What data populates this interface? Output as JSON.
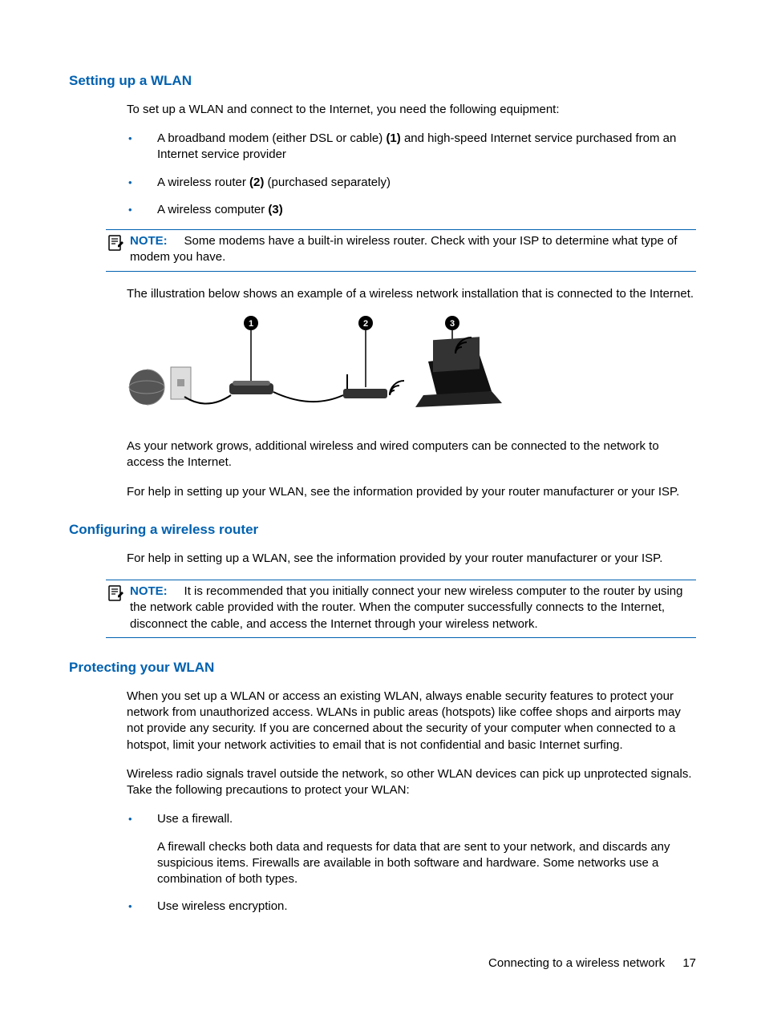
{
  "sec1": {
    "heading": "Setting up a WLAN",
    "intro": "To set up a WLAN and connect to the Internet, you need the following equipment:",
    "bullets": [
      {
        "pre": "A broadband modem (either DSL or cable) ",
        "bold": "(1)",
        "post": " and high-speed Internet service purchased from an Internet service provider"
      },
      {
        "pre": "A wireless router ",
        "bold": "(2)",
        "post": " (purchased separately)"
      },
      {
        "pre": "A wireless computer ",
        "bold": "(3)",
        "post": ""
      }
    ],
    "note_label": "NOTE:",
    "note_text": "Some modems have a built-in wireless router. Check with your ISP to determine what type of modem you have.",
    "illus_caption": "The illustration below shows an example of a wireless network installation that is connected to the Internet.",
    "after1": "As your network grows, additional wireless and wired computers can be connected to the network to access the Internet.",
    "after2": "For help in setting up your WLAN, see the information provided by your router manufacturer or your ISP."
  },
  "sec2": {
    "heading": "Configuring a wireless router",
    "p1": "For help in setting up a WLAN, see the information provided by your router manufacturer or your ISP.",
    "note_label": "NOTE:",
    "note_text": "It is recommended that you initially connect your new wireless computer to the router by using the network cable provided with the router. When the computer successfully connects to the Internet, disconnect the cable, and access the Internet through your wireless network."
  },
  "sec3": {
    "heading": "Protecting your WLAN",
    "p1": "When you set up a WLAN or access an existing WLAN, always enable security features to protect your network from unauthorized access. WLANs in public areas (hotspots) like coffee shops and airports may not provide any security. If you are concerned about the security of your computer when connected to a hotspot, limit your network activities to email that is not confidential and basic Internet surfing.",
    "p2": "Wireless radio signals travel outside the network, so other WLAN devices can pick up unprotected signals. Take the following precautions to protect your WLAN:",
    "bullets": [
      {
        "title": "Use a firewall.",
        "desc": "A firewall checks both data and requests for data that are sent to your network, and discards any suspicious items. Firewalls are available in both software and hardware. Some networks use a combination of both types."
      },
      {
        "title": "Use wireless encryption.",
        "desc": ""
      }
    ]
  },
  "footer": {
    "section": "Connecting to a wireless network",
    "page": "17"
  },
  "illustration": {
    "callouts": [
      "1",
      "2",
      "3"
    ],
    "elements": [
      "globe-internet",
      "wall-jack",
      "modem",
      "wireless-router",
      "wifi-signal",
      "laptop"
    ]
  }
}
